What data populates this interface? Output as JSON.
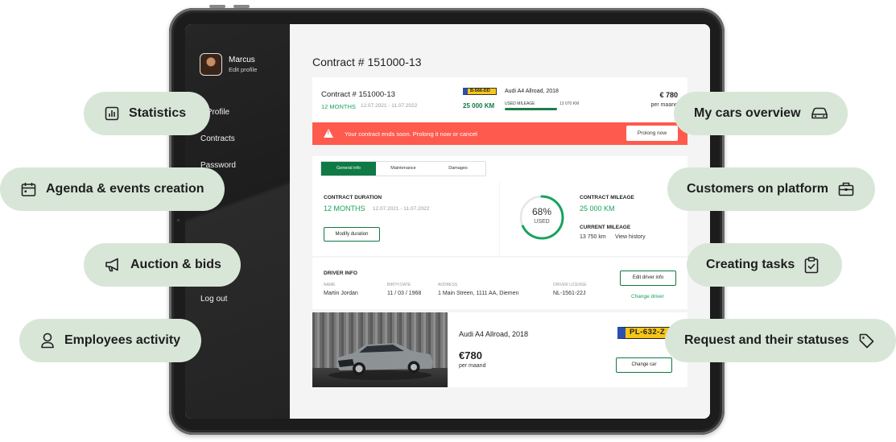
{
  "sidebar": {
    "profile_name": "Marcus",
    "edit_profile": "Edit profile",
    "nav": [
      "y Profile",
      "Contracts",
      "Password",
      "Log out"
    ]
  },
  "main": {
    "page_title": "Contract # 151000-13",
    "header": {
      "contract_title": "Contract # 151000-13",
      "months": "12 MONTHS",
      "dates": "12.07.2021 - 11.07.2022",
      "plate": "B-566-DD",
      "car_name": "Audi A4 Allroad, 2018",
      "km": "25 000 KM",
      "used_mileage_label": "USED MILEAGE",
      "used_mileage_value": "13 070 KM",
      "used_mileage_fraction": 0.52,
      "price": "€ 780",
      "per_month": "per maand"
    },
    "alert": {
      "message": "Your contract ends soon. Prolong it now or cancel",
      "button": "Prolong now"
    },
    "tabs": [
      "General info",
      "Maintenance",
      "Damages"
    ],
    "duration": {
      "label": "CONTRACT DURATION",
      "months": "12 MONTHS",
      "dates": "12.07.2021 - 11.07.2022",
      "button": "Modify duration"
    },
    "mileage": {
      "percent": "68%",
      "percent_value": 68,
      "used": "USED",
      "contract_label": "CONTRACT MILEAGE",
      "contract_value": "25 000 KM",
      "current_label": "CURRENT MILEAGE",
      "current_value": "13 750 km",
      "history_link": "View history"
    },
    "driver": {
      "section_label": "DRIVER INFO",
      "name_label": "NAME",
      "name": "Martin Jordan",
      "birth_label": "BIRTH DATE",
      "birth": "11 / 03 / 1968",
      "address_label": "ADDRESS",
      "address": "1 Main Streen, 1111 AA, Diemen",
      "license_label": "DRIVER LICENSE",
      "license": "NL-1561-22J",
      "edit_button": "Edit driver info",
      "change_link": "Change driver"
    },
    "car": {
      "name": "Audi A4 Allroad, 2018",
      "price": "€780",
      "per_month": "per maand",
      "plate": "PL-632-Z",
      "change_button": "Change car"
    }
  },
  "features": {
    "statistics": "Statistics",
    "agenda": "Agenda & events creation",
    "auction": "Auction & bids",
    "employees": "Employees activity",
    "my_cars": "My cars overview",
    "customers": "Customers on platform",
    "tasks": "Creating tasks",
    "requests": "Request and their statuses"
  },
  "colors": {
    "accent_green": "#0f7a44",
    "light_green": "#17a35c",
    "alert_red": "#ff5a4e",
    "pill_bg": "#d8e6d8",
    "sidebar_bg": "#1f1f1f"
  }
}
